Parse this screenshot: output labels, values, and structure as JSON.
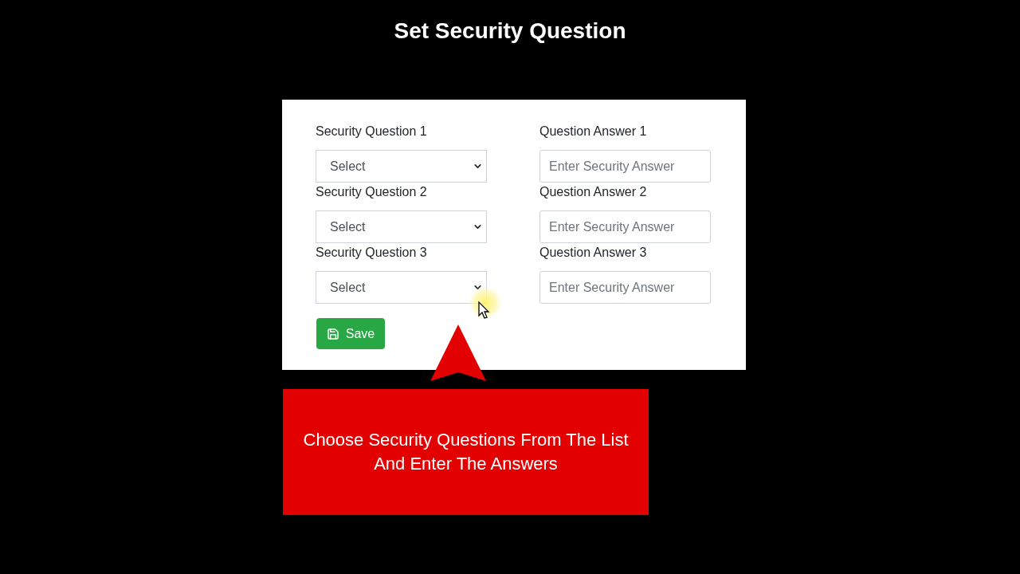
{
  "title": "Set Security Question",
  "form": {
    "rows": [
      {
        "question_label": "Security Question 1",
        "question_select": {
          "value": "Select"
        },
        "answer_label": "Question Answer 1",
        "answer_field": {
          "placeholder": "Enter Security Answer"
        }
      },
      {
        "question_label": "Security Question 2",
        "question_select": {
          "value": "Select"
        },
        "answer_label": "Question Answer 2",
        "answer_field": {
          "placeholder": "Enter Security Answer"
        }
      },
      {
        "question_label": "Security Question 3",
        "question_select": {
          "value": "Select"
        },
        "answer_label": "Question Answer 3",
        "answer_field": {
          "placeholder": "Enter Security Answer"
        }
      }
    ],
    "save_button": {
      "label": "Save"
    }
  },
  "callout": {
    "text": "Choose Security Questions From The List And Enter The Answers"
  }
}
